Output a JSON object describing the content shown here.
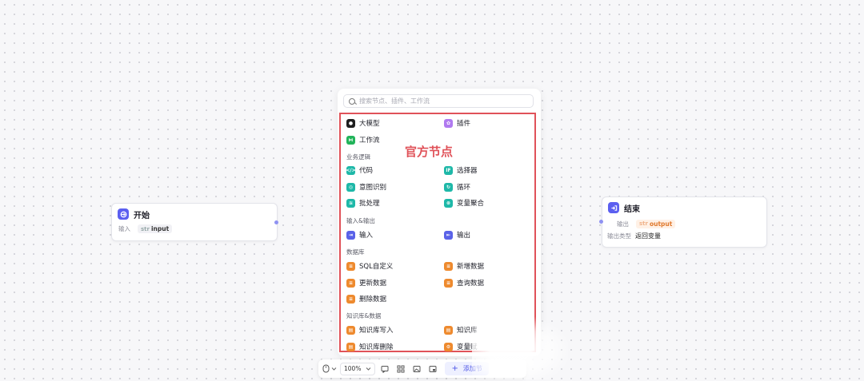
{
  "start_node": {
    "title": "开始",
    "input_label": "输入",
    "input_type": "str",
    "input_name": "input"
  },
  "end_node": {
    "title": "结束",
    "output_label": "输出",
    "output_type": "str",
    "output_name": "output",
    "output_kind_label": "输出类型",
    "output_kind_value": "返回变量"
  },
  "panel": {
    "search_placeholder": "搜索节点、插件、工作流",
    "overlay_label": "官方节点",
    "top_items": [
      {
        "label": "大模型",
        "icon": "llm-icon"
      },
      {
        "label": "插件",
        "icon": "plugin-icon"
      },
      {
        "label": "工作流",
        "icon": "workflow-icon"
      }
    ],
    "sections": [
      {
        "title": "业务逻辑",
        "items": [
          {
            "label": "代码",
            "icon": "code-icon"
          },
          {
            "label": "选择器",
            "icon": "if-icon"
          },
          {
            "label": "意图识别",
            "icon": "intent-icon"
          },
          {
            "label": "循环",
            "icon": "loop-icon"
          },
          {
            "label": "批处理",
            "icon": "batch-icon"
          },
          {
            "label": "变量聚合",
            "icon": "variable-aggregate-icon"
          }
        ]
      },
      {
        "title": "输入&输出",
        "items": [
          {
            "label": "输入",
            "icon": "input-icon"
          },
          {
            "label": "输出",
            "icon": "output-icon"
          }
        ]
      },
      {
        "title": "数据库",
        "items": [
          {
            "label": "SQL自定义",
            "icon": "sql-icon"
          },
          {
            "label": "新增数据",
            "icon": "db-add-icon"
          },
          {
            "label": "更新数据",
            "icon": "db-update-icon"
          },
          {
            "label": "查询数据",
            "icon": "db-query-icon"
          },
          {
            "label": "删除数据",
            "icon": "db-delete-icon"
          }
        ]
      },
      {
        "title": "知识库&数据",
        "items": [
          {
            "label": "知识库写入",
            "icon": "kb-write-icon"
          },
          {
            "label": "知识库",
            "icon": "kb-icon"
          },
          {
            "label": "知识库删除",
            "icon": "kb-delete-icon"
          },
          {
            "label": "变量赋",
            "icon": "variable-assign-icon"
          }
        ]
      }
    ]
  },
  "toolbar": {
    "zoom": "100%",
    "add_node_label": "添加节"
  }
}
